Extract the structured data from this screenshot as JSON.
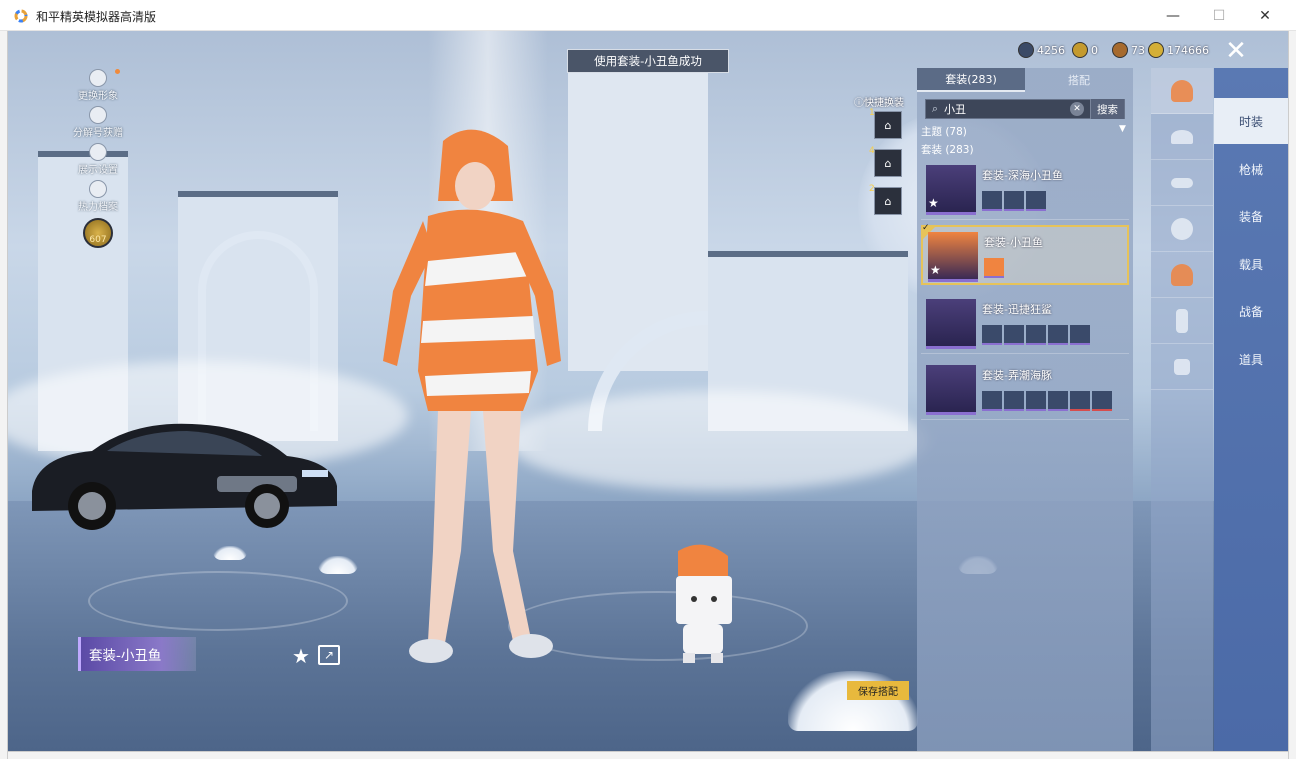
{
  "window": {
    "title": "和平精英模拟器高清版",
    "minimize": "—",
    "maximize": "☐",
    "close": "✕"
  },
  "toast": "使用套装-小丑鱼成功",
  "left_menu": [
    {
      "label": "更换形象"
    },
    {
      "label": "分解号获赠"
    },
    {
      "label": "展示设置"
    },
    {
      "label": "热力档案"
    }
  ],
  "badge_level": "607",
  "currency": [
    {
      "icon": "silver-coin-icon",
      "value": "4256",
      "color": "#3b4a66"
    },
    {
      "icon": "gold-emblem-icon",
      "value": "0",
      "color": "#c49a2e"
    },
    {
      "icon": "bronze-coin-icon",
      "value": "73",
      "color": "#a66a2e"
    },
    {
      "icon": "gold-coin-icon",
      "value": "174666",
      "color": "#d4af37"
    }
  ],
  "close_label": "✕",
  "quick_swap": {
    "label": "快捷换装",
    "slots": [
      {
        "num": "1",
        "label": "1"
      },
      {
        "num": "4",
        "label": "4"
      },
      {
        "num": "2",
        "label": "2"
      }
    ]
  },
  "panel": {
    "tabs": [
      {
        "label": "套装(283)"
      },
      {
        "label": "搭配"
      }
    ],
    "search": {
      "value": "小丑",
      "button": "搜索",
      "clear": "✕",
      "icon": "⌕"
    },
    "filter_theme": "主题 (78)",
    "filter_suit": "套装 (283)",
    "suits": [
      {
        "name": "套装-深海小丑鱼",
        "item_count": 3
      },
      {
        "name": "套装-小丑鱼",
        "item_count": 1
      },
      {
        "name": "套装-迅捷狂鲨",
        "item_count": 5
      },
      {
        "name": "套装-弄潮海豚",
        "item_count": 6
      }
    ]
  },
  "categories": [
    "outfit-icon",
    "hat-icon",
    "glasses-icon",
    "mask-icon",
    "top-icon",
    "pants-icon",
    "shoes-icon"
  ],
  "right_nav": [
    {
      "label": "时装"
    },
    {
      "label": "枪械"
    },
    {
      "label": "装备"
    },
    {
      "label": "载具"
    },
    {
      "label": "战备"
    },
    {
      "label": "道具"
    }
  ],
  "current_outfit": "套装-小丑鱼",
  "save_button": "保存搭配",
  "colors": {
    "accent_gold": "#e6c35a",
    "nav_blue": "#4b6aa7",
    "outfit_orange": "#f08440"
  }
}
